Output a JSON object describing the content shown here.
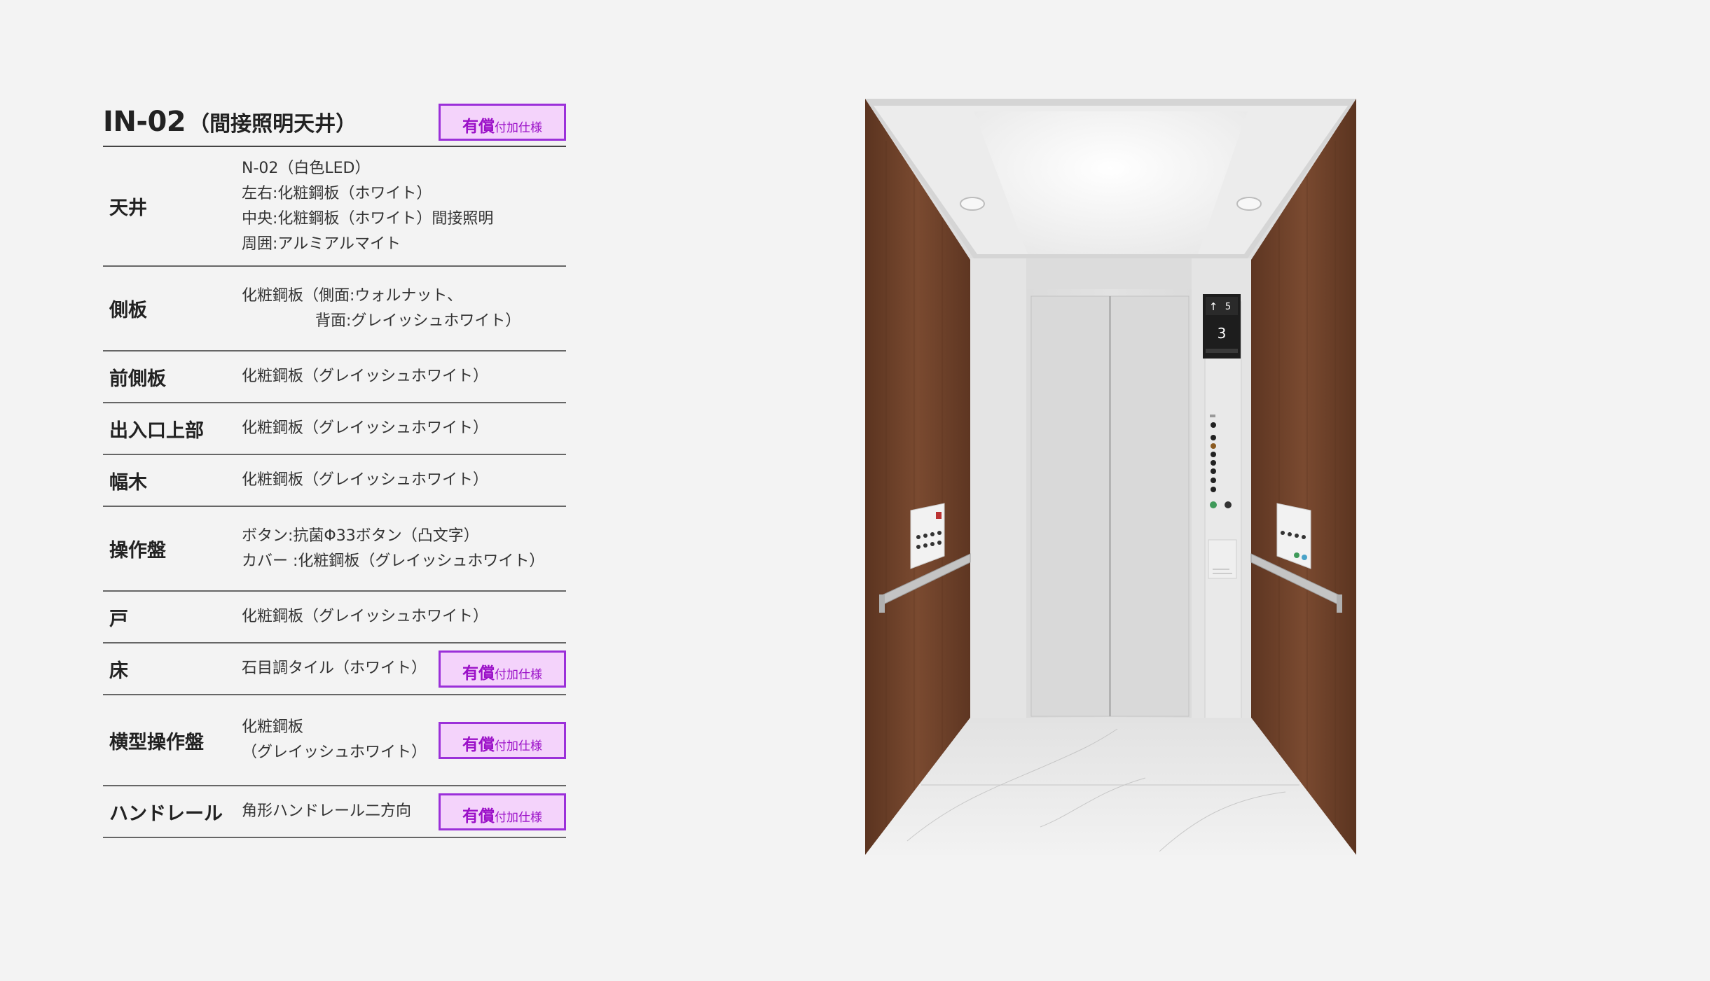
{
  "header": {
    "code": "IN-02",
    "subtitle": "（間接照明天井）",
    "badge_main": "有償",
    "badge_sub": "付加仕様"
  },
  "rows": [
    {
      "label": "天井",
      "lines": [
        "N-02（白色LED）",
        "左右:化粧鋼板（ホワイト）",
        "中央:化粧鋼板（ホワイト）間接照明",
        "周囲:アルミアルマイト"
      ]
    },
    {
      "label": "側板",
      "lines": [
        "化粧鋼板（側面:ウォルナット、",
        "背面:グレイッシュホワイト）"
      ]
    },
    {
      "label": "前側板",
      "lines": [
        "化粧鋼板（グレイッシュホワイト）"
      ]
    },
    {
      "label": "出入口上部",
      "lines": [
        "化粧鋼板（グレイッシュホワイト）"
      ]
    },
    {
      "label": "幅木",
      "lines": [
        "化粧鋼板（グレイッシュホワイト）"
      ]
    },
    {
      "label": "操作盤",
      "lines": [
        "ボタン:抗菌Φ33ボタン（凸文字）",
        "カバー :化粧鋼板（グレイッシュホワイト）"
      ]
    },
    {
      "label": "戸",
      "lines": [
        "化粧鋼板（グレイッシュホワイト）"
      ]
    },
    {
      "label": "床",
      "lines": [
        "石目調タイル（ホワイト）"
      ],
      "badge_main": "有償",
      "badge_sub": "付加仕様"
    },
    {
      "label": "横型操作盤",
      "lines": [
        "化粧鋼板",
        "（グレイッシュホワイト）"
      ],
      "badge_main": "有償",
      "badge_sub": "付加仕様"
    },
    {
      "label": "ハンドレール",
      "lines": [
        "角形ハンドレール二方向"
      ],
      "badge_main": "有償",
      "badge_sub": "付加仕様"
    }
  ],
  "display": {
    "arrow": "↑",
    "next_floor": "5",
    "current_floor": "3"
  },
  "colors": {
    "badge_border": "#9b30d9",
    "badge_bg": "#f4d3fb",
    "badge_text": "#9b10c8",
    "walnut": "#6b3f27"
  }
}
